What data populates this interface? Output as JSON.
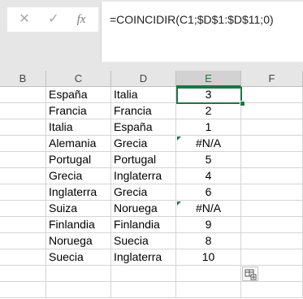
{
  "formula_bar": {
    "cancel_icon": "✕",
    "enter_icon": "✓",
    "fx_label": "fx",
    "formula": "=COINCIDIR(C1;$D$1:$D$11;0)"
  },
  "columns": [
    "B",
    "C",
    "D",
    "E",
    "F"
  ],
  "selected_column": "E",
  "rows": [
    {
      "c": "España",
      "d": "Italia",
      "e": "3",
      "error": false
    },
    {
      "c": "Francia",
      "d": "Francia",
      "e": "2",
      "error": false
    },
    {
      "c": "Italia",
      "d": "España",
      "e": "1",
      "error": false
    },
    {
      "c": "Alemania",
      "d": "Grecia",
      "e": "#N/A",
      "error": true
    },
    {
      "c": "Portugal",
      "d": "Portugal",
      "e": "5",
      "error": false
    },
    {
      "c": "Grecia",
      "d": "Inglaterra",
      "e": "4",
      "error": false
    },
    {
      "c": "Inglaterra",
      "d": "Grecia",
      "e": "6",
      "error": false
    },
    {
      "c": "Suiza",
      "d": "Noruega",
      "e": "#N/A",
      "error": true
    },
    {
      "c": "Finlandia",
      "d": "Finlandia",
      "e": "9",
      "error": false
    },
    {
      "c": "Noruega",
      "d": "Suecia",
      "e": "8",
      "error": false
    },
    {
      "c": "Suecia",
      "d": "Inglaterra",
      "e": "10",
      "error": false
    }
  ],
  "colors": {
    "accent": "#217346",
    "grid": "#d4d4d4",
    "header_bg": "#e6e6e6"
  },
  "quick_analysis_icon": "quick-analysis-icon"
}
